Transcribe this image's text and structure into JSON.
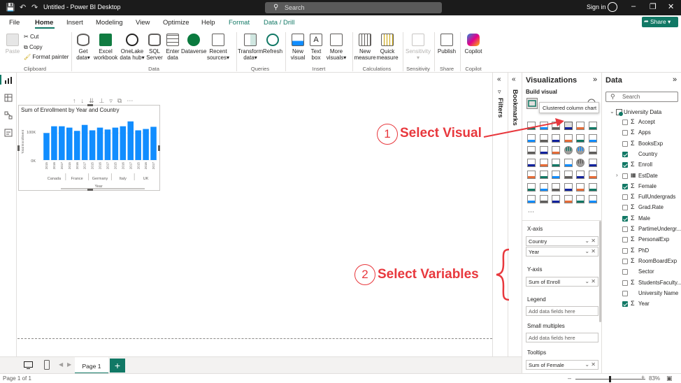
{
  "app": {
    "title": "Untitled - Power BI Desktop",
    "search_placeholder": "Search",
    "sign_in": "Sign in",
    "accent": "#117865"
  },
  "menu": {
    "tabs": [
      "File",
      "Home",
      "Insert",
      "Modeling",
      "View",
      "Optimize",
      "Help",
      "Format",
      "Data / Drill"
    ],
    "active": "Home",
    "share": "Share"
  },
  "ribbon": {
    "clipboard": {
      "paste": "Paste",
      "cut": "Cut",
      "copy": "Copy",
      "format_painter": "Format painter",
      "group": "Clipboard"
    },
    "data": {
      "get_data": [
        "Get",
        "data"
      ],
      "excel": [
        "Excel",
        "workbook"
      ],
      "onelake": [
        "OneLake",
        "data hub"
      ],
      "sql": [
        "SQL",
        "Server"
      ],
      "enter": [
        "Enter",
        "data"
      ],
      "dataverse": [
        "Dataverse",
        ""
      ],
      "recent": [
        "Recent",
        "sources"
      ],
      "group": "Data"
    },
    "queries": {
      "transform": [
        "Transform",
        "data"
      ],
      "refresh": [
        "Refresh",
        ""
      ],
      "group": "Queries"
    },
    "insert": {
      "new_visual": [
        "New",
        "visual"
      ],
      "text_box": [
        "Text",
        "box"
      ],
      "more_visuals": [
        "More",
        "visuals"
      ],
      "group": "Insert"
    },
    "calculations": {
      "new_measure": [
        "New",
        "measure"
      ],
      "quick_measure": [
        "Quick",
        "measure"
      ],
      "group": "Calculations"
    },
    "sensitivity": {
      "label": [
        "Sensitivity",
        ""
      ],
      "group": "Sensitivity"
    },
    "share": {
      "publish": [
        "Publish",
        ""
      ],
      "group": "Share"
    },
    "copilot": {
      "label": [
        "Copilot",
        ""
      ],
      "group": "Copilot"
    }
  },
  "chart_data": {
    "type": "bar",
    "title": "Sum of Enrollment by Year and Country",
    "ylabel": "Total Enrollment",
    "xlabel": "Year",
    "y_ticks": [
      "0K",
      "100K"
    ],
    "ylim": [
      0,
      150000
    ],
    "color": "#118dff",
    "groups": [
      "Canada",
      "France",
      "Germany",
      "Italy",
      "UK"
    ],
    "categories": [
      "2015",
      "2016",
      "2017",
      "2015",
      "2016",
      "2017",
      "2015",
      "2016",
      "2017",
      "2015",
      "2016",
      "2017",
      "2015",
      "2016",
      "2017"
    ],
    "values": [
      100000,
      125000,
      125000,
      120000,
      108000,
      130000,
      110000,
      120000,
      113000,
      120000,
      125000,
      143000,
      110000,
      115000,
      123000
    ]
  },
  "pages": {
    "tab": "Page 1",
    "status": "Page 1 of 1",
    "zoom": "83%"
  },
  "side": {
    "filters": "Filters",
    "bookmarks": "Bookmarks"
  },
  "viz": {
    "title": "Visualizations",
    "build_visual": "Build visual",
    "tooltip": "Clustered column chart",
    "xaxis_label": "X-axis",
    "xaxis_fields": [
      "Country",
      "Year"
    ],
    "yaxis_label": "Y-axis",
    "yaxis_fields": [
      "Sum of Enroll"
    ],
    "legend_label": "Legend",
    "legend_placeholder": "Add data fields here",
    "small_multiples_label": "Small multiples",
    "small_multiples_placeholder": "Add data fields here",
    "tooltips_label": "Tooltips",
    "tooltips_fields": [
      "Sum of Female"
    ]
  },
  "data_pane": {
    "title": "Data",
    "search_placeholder": "Search",
    "table": "University Data",
    "fields": [
      {
        "name": "Accept",
        "sigma": true,
        "checked": false
      },
      {
        "name": "Apps",
        "sigma": true,
        "checked": false
      },
      {
        "name": "BooksExp",
        "sigma": true,
        "checked": false
      },
      {
        "name": "Country",
        "sigma": false,
        "checked": true
      },
      {
        "name": "Enroll",
        "sigma": true,
        "checked": true
      },
      {
        "name": "EstDate",
        "sigma": false,
        "checked": false,
        "expand": true
      },
      {
        "name": "Female",
        "sigma": true,
        "checked": true
      },
      {
        "name": "FullUndergrads",
        "sigma": true,
        "checked": false
      },
      {
        "name": "Grad.Rate",
        "sigma": true,
        "checked": false
      },
      {
        "name": "Male",
        "sigma": true,
        "checked": true
      },
      {
        "name": "PartimeUndergr...",
        "sigma": true,
        "checked": false
      },
      {
        "name": "PersonalExp",
        "sigma": true,
        "checked": false
      },
      {
        "name": "PhD",
        "sigma": true,
        "checked": false
      },
      {
        "name": "RoomBoardExp",
        "sigma": true,
        "checked": false
      },
      {
        "name": "Sector",
        "sigma": false,
        "checked": false
      },
      {
        "name": "StudentsFaculty...",
        "sigma": true,
        "checked": false
      },
      {
        "name": "University Name",
        "sigma": false,
        "checked": false
      },
      {
        "name": "Year",
        "sigma": true,
        "checked": true
      }
    ]
  },
  "annotations": {
    "step1_number": "1",
    "step1_text": "Select Visual",
    "step2_number": "2",
    "step2_text": "Select Variables",
    "color": "#e8383d"
  }
}
